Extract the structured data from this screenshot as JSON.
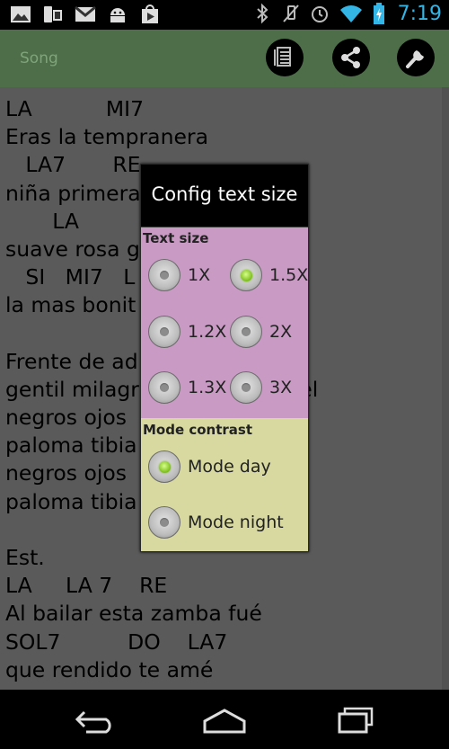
{
  "status_bar": {
    "time": "7:19",
    "left_icons": [
      "gallery-icon",
      "device-icon",
      "gmail-icon",
      "android-icon",
      "play-store-icon"
    ],
    "right_icons": [
      "bluetooth-icon",
      "mute-icon",
      "alarm-icon",
      "wifi-icon",
      "battery-icon"
    ]
  },
  "action_bar": {
    "title": "Song",
    "buttons": [
      "text-size-icon",
      "share-icon",
      "wrench-icon"
    ]
  },
  "lyrics": [
    "LA           MI7",
    "Eras la tempranera",
    "   LA7       RE",
    "niña primera, no",
    "       LA",
    "suave rosa g",
    "   SI   MI7   L",
    "la mas bonit",
    "",
    "Frente de ad",
    "gentil milagr                     piel",
    "negros ojos",
    "paloma tibia",
    "negros ojos",
    "paloma tibia",
    "",
    "Est.",
    "LA     LA 7    RE",
    "Al bailar esta zamba fué",
    "SOL7          DO    LA7",
    "que rendido te amé"
  ],
  "dialog": {
    "title": "Config text size",
    "text_size_label": "Text size",
    "size_options": [
      {
        "label": "1X",
        "selected": false
      },
      {
        "label": "1.5X",
        "selected": true
      },
      {
        "label": "1.2X",
        "selected": false
      },
      {
        "label": "2X",
        "selected": false
      },
      {
        "label": "1.3X",
        "selected": false
      },
      {
        "label": "3X",
        "selected": false
      }
    ],
    "mode_label": "Mode contrast",
    "mode_options": [
      {
        "label": "Mode day",
        "selected": true
      },
      {
        "label": "Mode night",
        "selected": false
      }
    ]
  },
  "colors": {
    "action_bar": "#4d6e49",
    "content_bg": "#5a5a5a",
    "size_panel": "#c99ac4",
    "mode_panel": "#d7d9a1",
    "radio_selected": "#7bbd1b",
    "clock": "#33b5e5"
  },
  "nav_bar": {
    "buttons": [
      "back-icon",
      "home-icon",
      "recent-apps-icon"
    ]
  }
}
